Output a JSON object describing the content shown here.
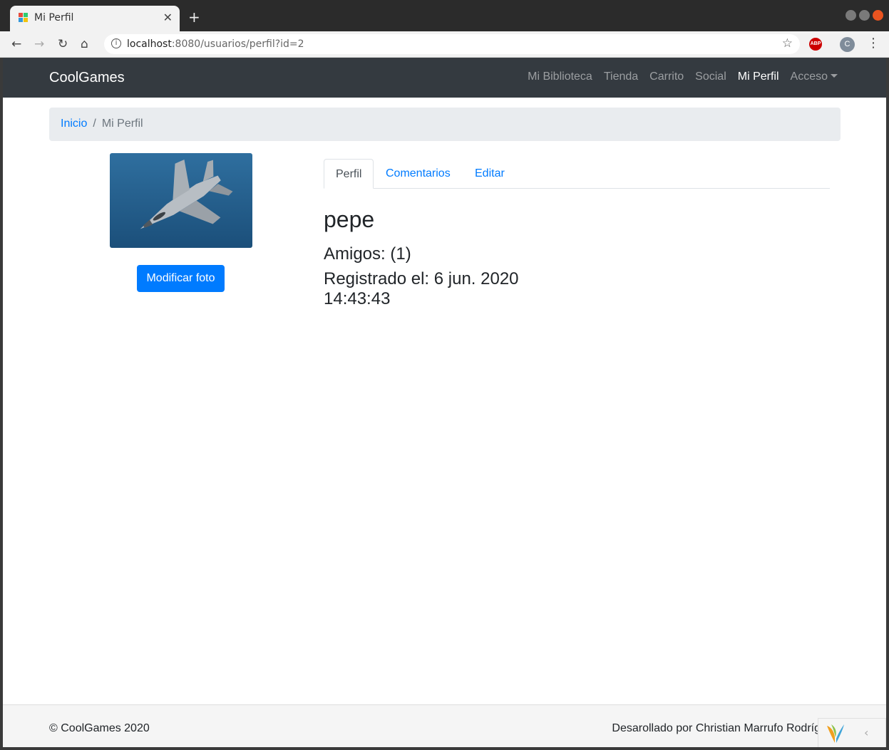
{
  "browser": {
    "tab_title": "Mi Perfil",
    "tab_close": "✕",
    "new_tab": "+",
    "url_host": "localhost",
    "url_rest": ":8080/usuarios/perfil?id=2",
    "profile_initial": "C",
    "abp_label": "ABP"
  },
  "navbar": {
    "brand": "CoolGames",
    "links": [
      "Mi Biblioteca",
      "Tienda",
      "Carrito",
      "Social",
      "Mi Perfil"
    ],
    "dropdown": "Acceso",
    "active": "Mi Perfil"
  },
  "breadcrumb": {
    "home": "Inicio",
    "separator": "/",
    "current": "Mi Perfil"
  },
  "profile": {
    "button": "Modificar foto",
    "tabs": [
      "Perfil",
      "Comentarios",
      "Editar"
    ],
    "active_tab": "Perfil",
    "username": "pepe",
    "friends": "Amigos: (1)",
    "registered": "Registrado el: 6 jun. 2020 14:43:43"
  },
  "footer": {
    "copyright": "© CoolGames 2020",
    "credits": "Desarollado por Christian Marrufo Rodríg"
  },
  "colors": {
    "navbar": "#343a40",
    "primary": "#007bff",
    "breadcrumb_bg": "#e9ecef"
  }
}
